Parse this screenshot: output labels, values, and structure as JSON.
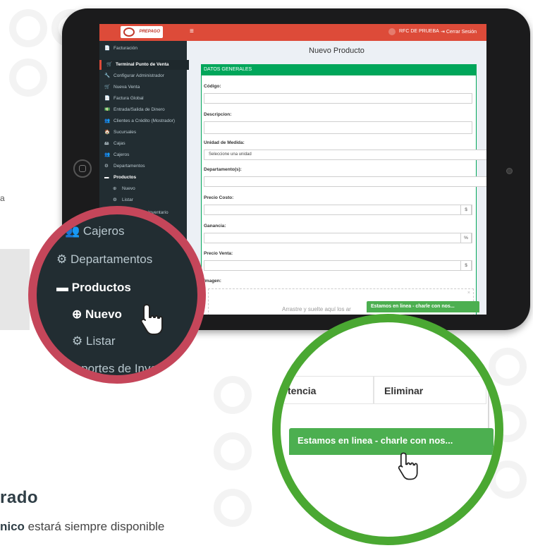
{
  "colors": {
    "topbar": "#dd4b39",
    "sidebar": "#222d32",
    "accent_green": "#00a65a",
    "chat_green": "#4caf50",
    "red_ring": "#c5465a",
    "green_ring": "#4aa832"
  },
  "left_fragment_a": "a",
  "heading_fragment": "rado",
  "bottom_text": {
    "bold": "nico",
    "rest": " estará siempre disponible"
  },
  "app": {
    "logo_text": "PREPAGO",
    "menu_toggle": "≡",
    "user_name": "RFC DE PRUEBA",
    "logout_label": "Cerrar Sesión"
  },
  "sidebar": {
    "items": [
      {
        "icon": "📄",
        "label": "Facturación"
      },
      {
        "icon": "🛒",
        "label": "Terminal Punto de Venta"
      },
      {
        "icon": "🔧",
        "label": "Configurar Administrador"
      },
      {
        "icon": "🛒",
        "label": "Nueva Venta"
      },
      {
        "icon": "📄",
        "label": "Factura Global"
      },
      {
        "icon": "💵",
        "label": "Entrada/Salida de Dinero"
      },
      {
        "icon": "👥",
        "label": "Clientes a Crédito (Mostrador)"
      },
      {
        "icon": "🏠",
        "label": "Sucursales"
      },
      {
        "icon": "🖴",
        "label": "Cajas"
      },
      {
        "icon": "👥",
        "label": "Cajeros"
      },
      {
        "icon": "⚙",
        "label": "Departamentos"
      },
      {
        "icon": "▬",
        "label": "Productos"
      },
      {
        "icon": "⊕",
        "label": "Nuevo"
      },
      {
        "icon": "⚙",
        "label": "Listar"
      },
      {
        "icon": "",
        "label": "de Inventario"
      }
    ]
  },
  "form": {
    "page_title": "Nuevo Producto",
    "section_title": "DATOS GENERALES",
    "codigo_label": "Código:",
    "descripcion_label": "Descripcion:",
    "unidad_label": "Unidad de Medida:",
    "unidad_value": "Seleccione una unidad",
    "departamento_label": "Departamento(s):",
    "precio_costo_label": "Precio Costo:",
    "ganancia_label": "Ganancia:",
    "precio_venta_label": "Precio Venta:",
    "imagen_label": "Imagen:",
    "dropzone_text": "Arrastre y suelte aquí los ar",
    "dropzone_close": "×",
    "currency_addon": "$",
    "percent_addon": "%"
  },
  "chat_label": "Estamos en linea - charle con nos...",
  "zoom_red": {
    "items": [
      {
        "icon": "👥",
        "label": "Cajeros"
      },
      {
        "icon": "⚙",
        "label": "Departamentos"
      },
      {
        "icon": "▬",
        "label": "Productos"
      },
      {
        "icon": "⊕",
        "label": "Nuevo"
      },
      {
        "icon": "⚙",
        "label": "Listar"
      },
      {
        "icon": "⛉",
        "label": "Reportes de Inve"
      }
    ]
  },
  "zoom_green": {
    "col_partial": "tencia",
    "col_delete": "Eliminar"
  }
}
